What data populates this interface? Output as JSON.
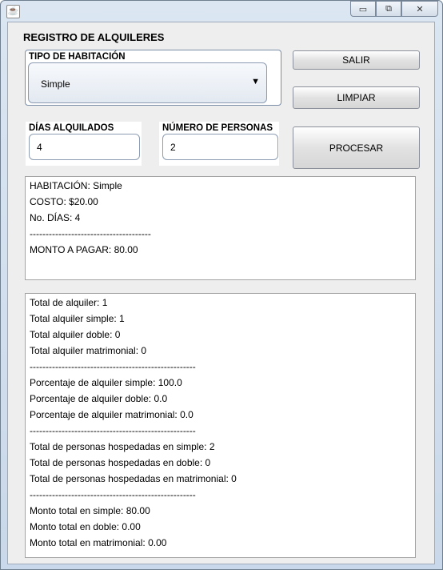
{
  "window": {
    "icon": "java-icon",
    "min_label": "▭",
    "max_label": "⧉",
    "close_label": "✕"
  },
  "form": {
    "title": "REGISTRO DE ALQUILERES"
  },
  "room_type": {
    "label": "TIPO DE HABITACIÓN",
    "selected": "Simple",
    "arrow": "▼"
  },
  "buttons": {
    "exit": "SALIR",
    "clear": "LIMPIAR",
    "process": "PROCESAR"
  },
  "days": {
    "label": "DÍAS ALQUILADOS",
    "value": "4"
  },
  "people": {
    "label": "NÚMERO DE PERSONAS",
    "value": "2"
  },
  "result_lines": [
    "HABITACIÓN: Simple",
    "COSTO: $20.00",
    "No. DÍAS: 4",
    "--------------------------------------",
    "MONTO A PAGAR: 80.00"
  ],
  "summary_lines": [
    "Total de alquiler: 1",
    "Total alquiler simple: 1",
    "Total alquiler doble: 0",
    "Total alquiler matrimonial: 0",
    "----------------------------------------------------",
    "Porcentaje de alquiler simple: 100.0",
    "Porcentaje de alquiler doble: 0.0",
    "Porcentaje de alquiler matrimonial: 0.0",
    "----------------------------------------------------",
    "Total de personas hospedadas en simple: 2",
    "Total de personas hospedadas en doble: 0",
    "Total de personas hospedadas en matrimonial: 0",
    "----------------------------------------------------",
    "Monto total en simple: 80.00",
    "Monto total en doble: 0.00",
    "Monto total en matrimonial: 0.00"
  ]
}
